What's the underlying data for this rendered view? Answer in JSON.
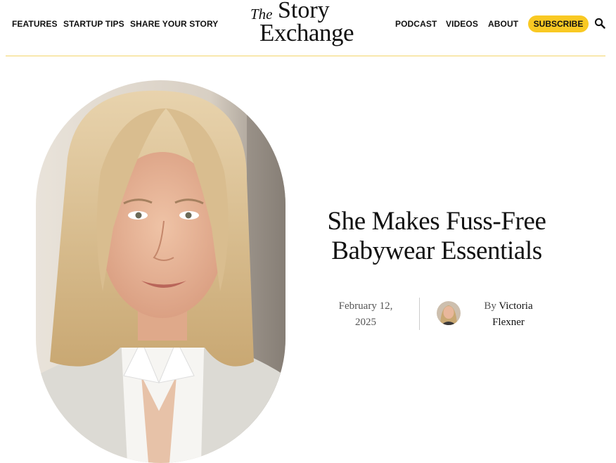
{
  "nav": {
    "left": [
      {
        "label": "FEATURES"
      },
      {
        "label": "STARTUP TIPS"
      },
      {
        "label": "SHARE YOUR STORY"
      }
    ],
    "right": [
      {
        "label": "PODCAST"
      },
      {
        "label": "VIDEOS"
      },
      {
        "label": "ABOUT"
      }
    ],
    "subscribe_label": "SUBSCRIBE",
    "search_icon": "search-icon"
  },
  "logo": {
    "the": "The",
    "story": "Story",
    "exchange": "Exchange"
  },
  "article": {
    "title_line1": "She Makes Fuss-Free",
    "title_line2": "Babywear Essentials",
    "date_line1": "February 12,",
    "date_line2": "2025",
    "by": "By",
    "author_first": "Victoria",
    "author_last": "Flexner"
  },
  "colors": {
    "accent": "#f9c923",
    "divider": "#f3d56b",
    "text": "#111111",
    "muted": "#555555"
  }
}
